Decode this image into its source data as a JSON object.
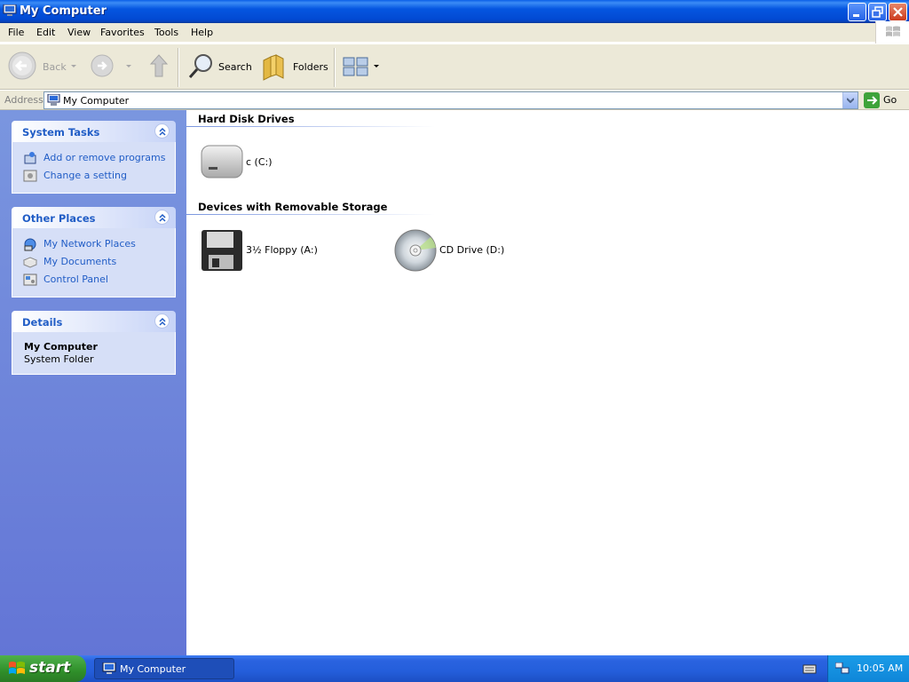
{
  "window": {
    "title": "My Computer",
    "controls": [
      "minimize",
      "maximize",
      "close"
    ]
  },
  "menubar": {
    "items": [
      "File",
      "Edit",
      "View",
      "Favorites",
      "Tools",
      "Help"
    ]
  },
  "toolbar": {
    "back_label": "Back",
    "search_label": "Search",
    "folders_label": "Folders"
  },
  "address": {
    "label": "Address",
    "value": "My Computer",
    "go_label": "Go"
  },
  "sidebar": {
    "system_tasks": {
      "title": "System Tasks",
      "items": [
        {
          "label": "Add or remove programs",
          "icon": "add-remove-programs-icon"
        },
        {
          "label": "Change a setting",
          "icon": "control-setting-icon"
        }
      ]
    },
    "other_places": {
      "title": "Other Places",
      "items": [
        {
          "label": "My Network Places",
          "icon": "network-places-icon"
        },
        {
          "label": "My Documents",
          "icon": "my-documents-icon"
        },
        {
          "label": "Control Panel",
          "icon": "control-panel-icon"
        }
      ]
    },
    "details": {
      "title": "Details",
      "name": "My Computer",
      "type": "System Folder"
    }
  },
  "content": {
    "groups": [
      {
        "title": "Hard Disk Drives",
        "items": [
          {
            "label": "c (C:)",
            "icon": "hard-drive-icon"
          }
        ]
      },
      {
        "title": "Devices with Removable Storage",
        "items": [
          {
            "label": "3½ Floppy (A:)",
            "icon": "floppy-drive-icon"
          },
          {
            "label": "CD Drive (D:)",
            "icon": "cd-drive-icon"
          }
        ]
      }
    ]
  },
  "taskbar": {
    "start_label": "start",
    "task_label": "My Computer",
    "clock": "10:05 AM"
  },
  "colors": {
    "titlebar": "#0556e0",
    "taskpane": "#6f86db",
    "link": "#215dc6",
    "start": "#2f8f2a"
  }
}
